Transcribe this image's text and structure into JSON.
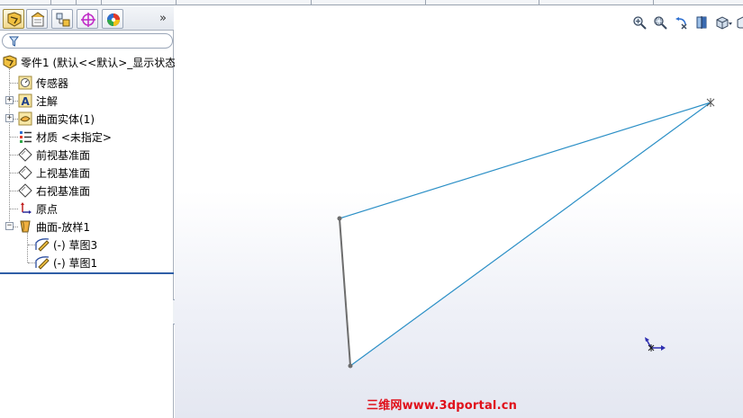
{
  "feature_manager": {
    "tabs": [
      "feature-tree-icon",
      "property-manager-icon",
      "configuration-manager-icon",
      "dimxpert-icon",
      "display-manager-icon"
    ],
    "overflow_label": "»",
    "filter_icon": "filter-icon",
    "tree": {
      "root": {
        "label": "零件1  (默认<<默认>_显示状态",
        "icon": "part-icon"
      },
      "items": [
        {
          "label": "传感器",
          "icon": "sensor-icon"
        },
        {
          "label": "注解",
          "icon": "annotation-icon"
        },
        {
          "label": "曲面实体(1)",
          "icon": "surface-bodies-icon"
        },
        {
          "label": "材质 <未指定>",
          "icon": "material-icon"
        },
        {
          "label": "前视基准面",
          "icon": "plane-icon"
        },
        {
          "label": "上视基准面",
          "icon": "plane-icon"
        },
        {
          "label": "右视基准面",
          "icon": "plane-icon"
        },
        {
          "label": "原点",
          "icon": "origin-icon"
        },
        {
          "label": "曲面-放样1",
          "icon": "surface-loft-icon"
        },
        {
          "label": "(-) 草图3",
          "icon": "sketch-icon"
        },
        {
          "label": "(-) 草图1",
          "icon": "sketch-icon"
        }
      ]
    }
  },
  "view_toolbar": [
    "zoom-to-fit-icon",
    "zoom-to-area-icon",
    "previous-view-icon",
    "section-view-icon",
    "view-orientation-icon"
  ],
  "viewport": {
    "watermark": "三维网www.3dportal.cn"
  },
  "colors": {
    "sketch_line": "#2b8fc6",
    "sketch_edge": "#6d6d6d",
    "watermark": "#e0101a",
    "rollback_bar": "#2f5fa7"
  }
}
